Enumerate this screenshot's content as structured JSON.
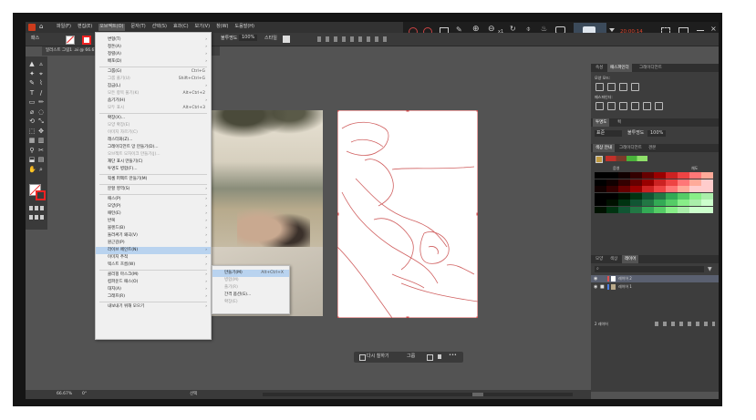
{
  "menubar": {
    "items": [
      "파일(F)",
      "편집(E)",
      "오브젝트(O)",
      "문자(T)",
      "선택(S)",
      "효과(C)",
      "보기(V)",
      "창(W)",
      "도움말(H)"
    ]
  },
  "recorder": {
    "time": "20:00:14",
    "zoom_label": "x1"
  },
  "ctrlbar": {
    "tool_label": "패스",
    "opacity_label": "불투명도",
    "opacity_value": "100%",
    "style_label": "스타일"
  },
  "document_tab": {
    "label": "일러스트 그림1 .ai @ 66.67% (RGB/GPU 미리 보기)"
  },
  "object_menu": {
    "items": [
      {
        "label": "변형(T)",
        "sub": true
      },
      {
        "label": "정돈(A)",
        "sub": true
      },
      {
        "label": "정렬(A)",
        "sub": true
      },
      {
        "label": "배포(D)",
        "sub": true
      },
      {
        "sep": true
      },
      {
        "label": "그룹(G)",
        "shortcut": "Ctrl+G"
      },
      {
        "label": "그룹 풀기(U)",
        "shortcut": "Shift+Ctrl+G",
        "disabled": true
      },
      {
        "label": "잠금(L)",
        "sub": true
      },
      {
        "label": "모든 항목 풀기(K)",
        "shortcut": "Alt+Ctrl+2",
        "disabled": true
      },
      {
        "label": "숨기기(H)",
        "sub": true
      },
      {
        "label": "모두 표시",
        "shortcut": "Alt+Ctrl+3",
        "disabled": true
      },
      {
        "sep": true
      },
      {
        "label": "확장(X)..."
      },
      {
        "label": "모양 확장(E)",
        "disabled": true
      },
      {
        "label": "이미지 자르기(C)",
        "disabled": true
      },
      {
        "label": "래스터화(Z)..."
      },
      {
        "label": "그레이디언트 망 만들기(D)..."
      },
      {
        "label": "오브젝트 모자이크 만들기(J)...",
        "disabled": true
      },
      {
        "label": "재단 표시 만들기(C)"
      },
      {
        "label": "투명도 병합(F)..."
      },
      {
        "sep": true
      },
      {
        "label": "픽셀 퍼펙트 만들기(M)"
      },
      {
        "sep": true
      },
      {
        "label": "분할 영역(S)",
        "sub": true
      },
      {
        "sep": true
      },
      {
        "label": "패스(P)",
        "sub": true
      },
      {
        "label": "모양(P)",
        "sub": true
      },
      {
        "label": "패턴(E)",
        "sub": true
      },
      {
        "label": "반복",
        "sub": true
      },
      {
        "label": "블렌드(B)",
        "sub": true
      },
      {
        "label": "둘러싸기 왜곡(V)",
        "sub": true
      },
      {
        "label": "원근감(P)",
        "sub": true
      },
      {
        "label": "라이브 페인트(N)",
        "sub": true,
        "highlight": true
      },
      {
        "label": "이미지 추적",
        "sub": true
      },
      {
        "label": "텍스트 흐름(W)",
        "sub": true
      },
      {
        "sep": true
      },
      {
        "label": "클리핑 마스크(M)",
        "sub": true
      },
      {
        "label": "컴파운드 패스(O)",
        "sub": true
      },
      {
        "label": "대지(A)",
        "sub": true
      },
      {
        "label": "그래프(R)",
        "sub": true
      },
      {
        "sep": true
      },
      {
        "label": "내보내기 위해 모으기",
        "sub": true
      }
    ]
  },
  "live_paint_menu": {
    "items": [
      {
        "label": "만들기(M)",
        "shortcut": "Alt+Ctrl+X",
        "highlight": true
      },
      {
        "label": "병합(M)",
        "disabled": true
      },
      {
        "label": "풀기(R)",
        "disabled": true
      },
      {
        "label": "간격 옵션(G)..."
      },
      {
        "label": "확장(E)",
        "disabled": true
      }
    ]
  },
  "context_bar": {
    "recolor_label": "다시 칠하기",
    "group_label": "그룹"
  },
  "panel_top": {
    "tabs": [
      "속성",
      "패스파인더",
      "그레이디언트"
    ],
    "shape_mode_label": "모양 모드:",
    "pathfinder_label": "패스파인더:"
  },
  "panel_transparency": {
    "tabs": [
      "투명도",
      "획"
    ],
    "blend_mode": "표준",
    "opacity_label": "불투명도",
    "opacity_value": "100%"
  },
  "panel_color": {
    "tabs": [
      "색상 안내",
      "그레이디언트",
      "견본"
    ],
    "left_label": "음영",
    "right_label": "채도",
    "colors": {
      "accent": "#c0302a",
      "green": "#49b23a"
    }
  },
  "panel_layers": {
    "tabs": [
      "모양",
      "색상",
      "레이어"
    ],
    "layers": [
      "레이어 2",
      "레이어 1"
    ],
    "footer": "2 레이어"
  },
  "status": {
    "zoom": "66.67%",
    "angle": "0°",
    "mode": "선택"
  }
}
